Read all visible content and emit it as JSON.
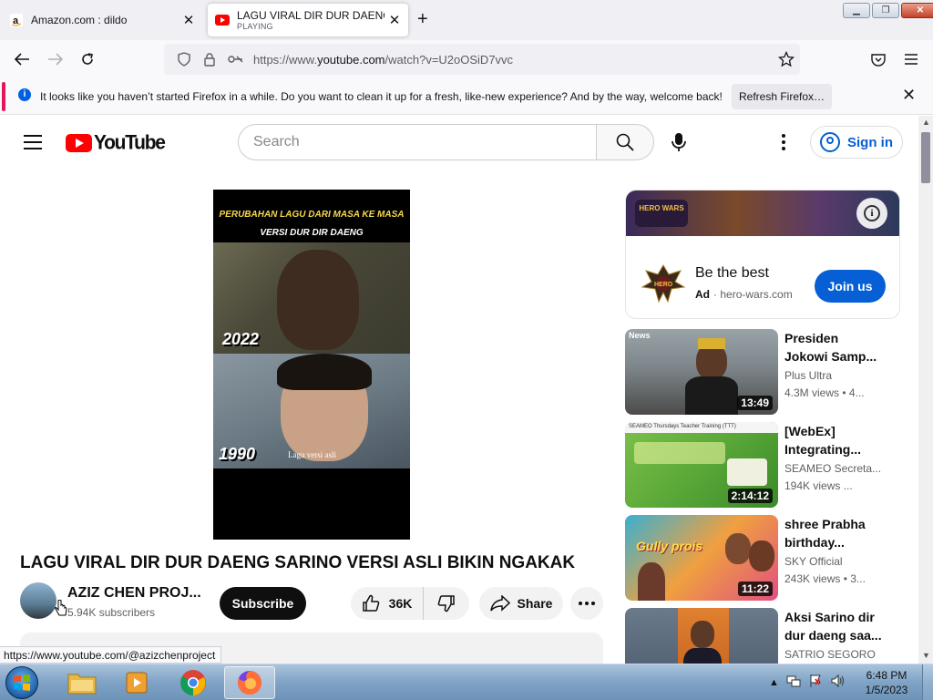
{
  "browser": {
    "tabs": [
      {
        "title": "Amazon.com : dildo",
        "active": false
      },
      {
        "title": "LAGU VIRAL DIR DUR DAENG SARINO VERSI ASLI BIKIN NGAKAK",
        "status": "PLAYING",
        "active": true
      }
    ],
    "url_prefix": "https://www.",
    "url_host": "youtube.com",
    "url_path": "/watch?v=U2oOSiD7vvc",
    "notification": {
      "message": "It looks like you haven’t started Firefox in a while. Do you want to clean it up for a fresh, like-new experience? And by the way, welcome back!",
      "button": "Refresh Firefox…"
    },
    "status_url": "https://www.youtube.com/@azizchenproject"
  },
  "youtube": {
    "logo_text": "YouTube",
    "search_placeholder": "Search",
    "signin_label": "Sign in",
    "video": {
      "overlay_line1": "PERUBAHAN LAGU DARI MASA KE MASA",
      "overlay_line2": "VERSI DUR DIR DAENG",
      "year_top": "2022",
      "year_bottom": "1990",
      "bottom_caption": "Lagu versi asli",
      "title": "LAGU VIRAL DIR DUR DAENG SARINO VERSI ASLI BIKIN NGAKAK",
      "channel": "AZIZ CHEN PROJ...",
      "subscribers": "5.94K subscribers",
      "subscribe_label": "Subscribe",
      "likes": "36K",
      "share_label": "Share"
    },
    "ad": {
      "banner_text": "HERO WARS",
      "title": "Be the best",
      "badge": "Ad",
      "domain": "hero-wars.com",
      "cta": "Join us"
    },
    "recommendations": [
      {
        "title1": "Presiden",
        "title2": "Jokowi Samp...",
        "channel": "Plus Ultra",
        "views": "4.3M views",
        "age": "• 4...",
        "duration": "13:49",
        "tag": "News"
      },
      {
        "title1": "[WebEx]",
        "title2": "Integrating...",
        "channel": "SEAMEO Secreta...",
        "views": "194K views",
        "age": "...",
        "duration": "2:14:12",
        "tag": "SEAMEO Thursdays Teacher Training (TTT)"
      },
      {
        "title1": "shree Prabha",
        "title2": "birthday...",
        "channel": "SKY Official",
        "views": "243K views",
        "age": "• 3...",
        "duration": "11:22",
        "tag": "Gully prois"
      },
      {
        "title1": "Aksi Sarino dir",
        "title2": "dur daeng saa...",
        "channel": "SATRIO SEGORO",
        "views": "",
        "age": "",
        "duration": "",
        "tag": ""
      }
    ]
  },
  "taskbar": {
    "time": "6:48 PM",
    "date": "1/5/2023"
  },
  "colors": {
    "youtube_red": "#ff0000",
    "link_blue": "#065fd4",
    "firefox_accent": "#e3165b"
  }
}
